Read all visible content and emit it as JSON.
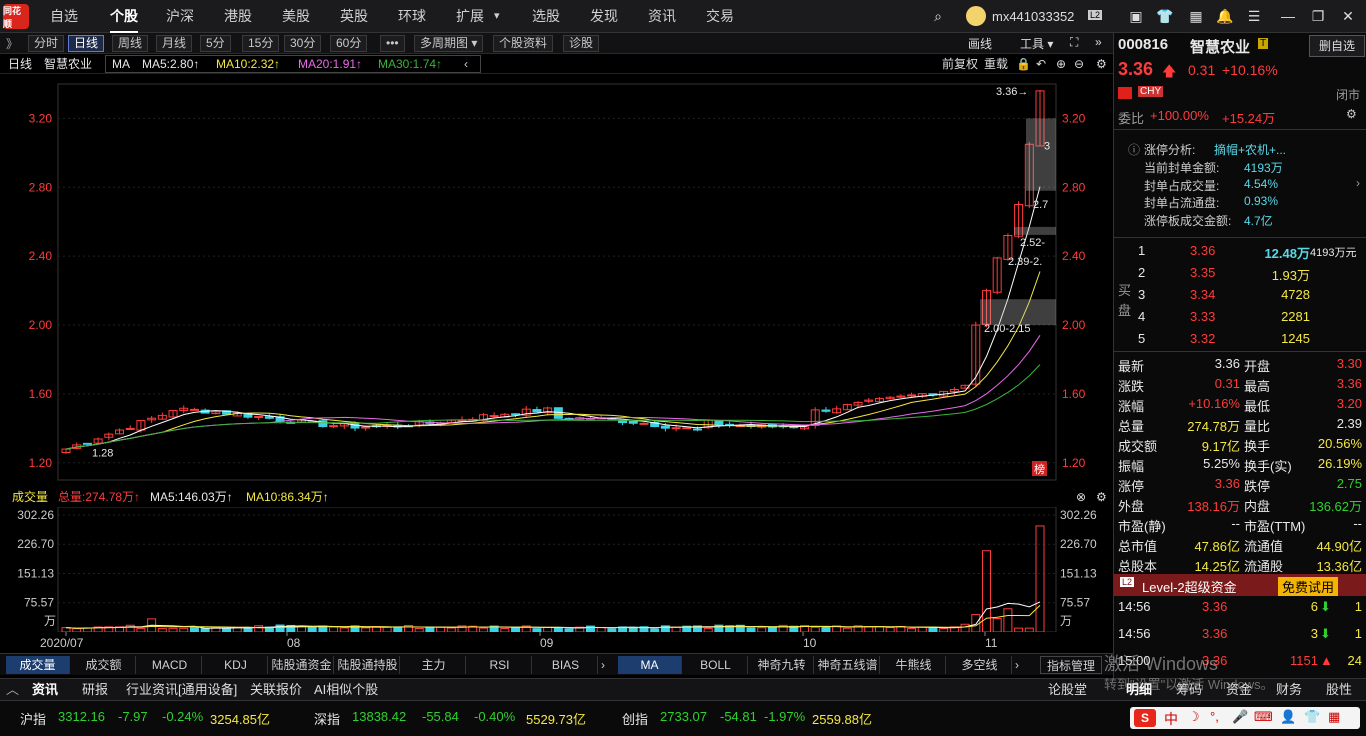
{
  "app": {
    "logo_text": "同花顺",
    "user": "mx441033352",
    "level_badge": "L2"
  },
  "nav": [
    "自选",
    "个股",
    "沪深",
    "港股",
    "美股",
    "英股",
    "环球",
    "扩展",
    "选股",
    "发现",
    "资讯",
    "交易"
  ],
  "nav_dropdown_caret": "▾",
  "toolbar": {
    "collapse": "》",
    "periods": [
      "分时",
      "日线",
      "周线",
      "月线",
      "5分",
      "15分",
      "30分",
      "60分"
    ],
    "more": "•••",
    "multi": "多周期图 ▾",
    "profile": "个股资料",
    "diag": "诊股",
    "right": [
      "画线",
      "工具 ▾"
    ]
  },
  "mabar": {
    "period": "日线",
    "name": "智慧农业",
    "ma": "MA",
    "ma5": "MA5:2.80↑",
    "ma10": "MA10:2.32↑",
    "ma20": "MA20:1.91↑",
    "ma30": "MA30:1.74↑",
    "adj": "前复权",
    "overlay": "重载"
  },
  "kline": {
    "price_ticks": [
      "3.20",
      "2.80",
      "2.40",
      "2.00",
      "1.60",
      "1.20"
    ],
    "annotations": {
      "high": "3.36→",
      "a3": "3",
      "a27": "2.7",
      "a252": "2.52-",
      "a239": "2.39-2.",
      "a200": "2.00-2.15",
      "low": "1.28"
    },
    "badge": "榜"
  },
  "volbar": {
    "title": "成交量",
    "total": "总量:274.78万↑",
    "ma5": "MA5:146.03万↑",
    "ma10": "MA10:86.34万↑"
  },
  "vol": {
    "ticks": [
      "302.26",
      "226.70",
      "151.13",
      "75.57"
    ],
    "unit": "万"
  },
  "xaxis": {
    "labels": [
      "2020/07",
      "08",
      "09",
      "10",
      "11"
    ]
  },
  "indicators_left": [
    "成交量",
    "成交额",
    "MACD",
    "KDJ",
    "陆股通资金",
    "陆股通持股",
    "主力",
    "RSI",
    "BIAS"
  ],
  "indicators_right": [
    "MA",
    "BOLL",
    "神奇九转",
    "神奇五线谱",
    "牛熊线",
    "多空线"
  ],
  "indicator_manage": "指标管理",
  "right": {
    "code": "000816",
    "name": "智慧农业",
    "flag": "T",
    "add": "删自选",
    "price": "3.36",
    "arrow": "🡅",
    "chg": "0.31",
    "pct": "+10.16%",
    "currency": "CHY",
    "closed": "闭市",
    "wb_label": "委比",
    "wb": "+100.00%",
    "wb2": "+15.24万",
    "zt_title": "涨停分析:",
    "zt_tags": "摘帽+农机+...",
    "zt_items": [
      [
        "当前封单金额:",
        "4193万"
      ],
      [
        "封单占成交量:",
        "4.54%"
      ],
      [
        "封单占流通盘:",
        "0.93%"
      ],
      [
        "涨停板成交金额:",
        "4.7亿"
      ]
    ],
    "buy_label": [
      "买",
      "盘"
    ],
    "bids": [
      [
        "1",
        "3.36",
        "12.48万",
        "4193万元"
      ],
      [
        "2",
        "3.35",
        "1.93万",
        ""
      ],
      [
        "3",
        "3.34",
        "4728",
        ""
      ],
      [
        "4",
        "3.33",
        "2281",
        ""
      ],
      [
        "5",
        "3.32",
        "1245",
        ""
      ]
    ],
    "stats": [
      [
        "最新",
        "3.36",
        "开盘",
        "3.30"
      ],
      [
        "涨跌",
        "0.31",
        "最高",
        "3.36"
      ],
      [
        "涨幅",
        "+10.16%",
        "最低",
        "3.20"
      ],
      [
        "总量",
        "274.78万",
        "量比",
        "2.39"
      ],
      [
        "成交额",
        "9.17亿",
        "换手",
        "20.56%"
      ],
      [
        "振幅",
        "5.25%",
        "换手(实)",
        "26.19%"
      ],
      [
        "涨停",
        "3.36",
        "跌停",
        "2.75"
      ],
      [
        "外盘",
        "138.16万",
        "内盘",
        "136.62万"
      ],
      [
        "市盈(静)",
        "--",
        "市盈(TTM)",
        "--"
      ],
      [
        "总市值",
        "47.86亿",
        "流通值",
        "44.90亿"
      ],
      [
        "总股本",
        "14.25亿",
        "流通股",
        "13.36亿"
      ]
    ],
    "l2": "Level-2超级资金",
    "trial": "免费试用",
    "ticks": [
      [
        "14:56",
        "3.36",
        "6",
        "1"
      ],
      [
        "14:56",
        "3.36",
        "3",
        "1"
      ],
      [
        "15:00",
        "3.36",
        "1151",
        "24"
      ]
    ]
  },
  "bottom": {
    "tabs": [
      "资讯",
      "研报",
      "行业资讯[通用设备]",
      "关联报价",
      "AI相似个股"
    ],
    "gubar": "论股堂",
    "rtabs": [
      "明细",
      "筹码",
      "资金",
      "财务",
      "股性"
    ]
  },
  "status": [
    {
      "n": "沪指",
      "v": "3312.16",
      "c": "-7.97",
      "p": "-0.24%",
      "a": "3254.85亿"
    },
    {
      "n": "深指",
      "v": "13838.42",
      "c": "-55.84",
      "p": "-0.40%",
      "a": "5529.73亿"
    },
    {
      "n": "创指",
      "v": "2733.07",
      "c": "-54.81",
      "p": "-1.97%",
      "a": "2559.88亿"
    }
  ],
  "watermark": {
    "l1": "激活 Windows",
    "l2": "转到\"设置\"以激活 Windows。"
  },
  "colors": {
    "up": "#ff3b3b",
    "down": "#3ad2e6",
    "ma5": "#ffffff",
    "ma10": "#f4e842",
    "ma20": "#e86ae8",
    "ma30": "#3bb33b"
  }
}
